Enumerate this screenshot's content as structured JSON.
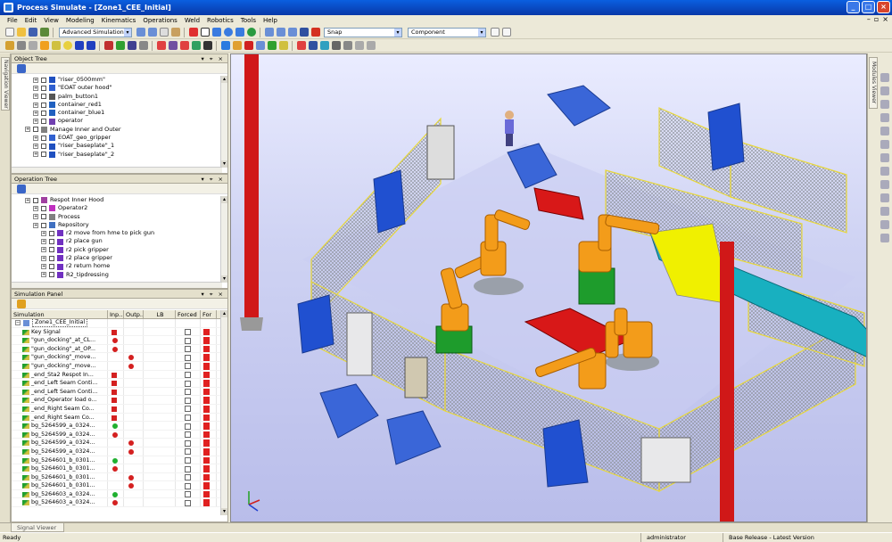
{
  "window": {
    "title": "Process Simulate - [Zone1_CEE_Initial]"
  },
  "menu": [
    "File",
    "Edit",
    "View",
    "Modeling",
    "Kinematics",
    "Operations",
    "Weld",
    "Robotics",
    "Tools",
    "Help"
  ],
  "toolbar": {
    "study_combo": "Advanced Simulation",
    "snap_combo": "Snap",
    "pick_combo": "Component"
  },
  "side_tabs": {
    "left": "Navigation Viewer",
    "right": "Modules Viewer"
  },
  "object_tree": {
    "title": "Object Tree",
    "items": [
      {
        "label": "\"riser_0500mm\"",
        "indent": 2,
        "icon": "part-icon"
      },
      {
        "label": "\"EOAT outer hood\"",
        "indent": 2,
        "icon": "gripper-icon"
      },
      {
        "label": "palm_button1",
        "indent": 2,
        "icon": "button-icon"
      },
      {
        "label": "container_red1",
        "indent": 2,
        "icon": "container-icon"
      },
      {
        "label": "container_blue1",
        "indent": 2,
        "icon": "container-icon"
      },
      {
        "label": "operator",
        "indent": 2,
        "icon": "human-icon"
      },
      {
        "label": "Manage Inner and Outer",
        "indent": 1,
        "icon": "station-icon"
      },
      {
        "label": "EOAT_geo_gripper",
        "indent": 2,
        "icon": "gripper-icon"
      },
      {
        "label": "\"riser_baseplate\"_1",
        "indent": 2,
        "icon": "part-icon"
      },
      {
        "label": "\"riser_baseplate\"_2",
        "indent": 2,
        "icon": "part-icon"
      }
    ]
  },
  "operation_tree": {
    "title": "Operation Tree",
    "items": [
      {
        "label": "Respot Inner Hood",
        "indent": 1,
        "icon": "compound-op-icon"
      },
      {
        "label": "Operator2",
        "indent": 2,
        "icon": "human-op-icon"
      },
      {
        "label": "Process",
        "indent": 2,
        "icon": "process-icon"
      },
      {
        "label": "Repository",
        "indent": 2,
        "icon": "repository-icon"
      },
      {
        "label": "r2 move from hme to pick gun",
        "indent": 3,
        "icon": "robot-op-icon"
      },
      {
        "label": "r2 place gun",
        "indent": 3,
        "icon": "robot-op-icon"
      },
      {
        "label": "r2 pick gripper",
        "indent": 3,
        "icon": "robot-op-icon"
      },
      {
        "label": "r2 place gripper",
        "indent": 3,
        "icon": "robot-op-icon"
      },
      {
        "label": "r2 return home",
        "indent": 3,
        "icon": "robot-op-icon"
      },
      {
        "label": "R2_tipdressing",
        "indent": 3,
        "icon": "robot-op-icon"
      }
    ]
  },
  "simulation_panel": {
    "title": "Simulation Panel",
    "columns": [
      "Simulation",
      "Inp...",
      "Outp...",
      "LB",
      "Forced",
      "For"
    ],
    "root": "Zone1_CEE_Initial",
    "rows": [
      {
        "name": "Key Signal",
        "input": "square",
        "output": ""
      },
      {
        "name": "\"gun_docking\"_at_CL...",
        "input": "red",
        "output": ""
      },
      {
        "name": "\"gun_docking\"_at_OP...",
        "input": "red",
        "output": ""
      },
      {
        "name": "\"gun_docking\"_move...",
        "input": "",
        "output": "red"
      },
      {
        "name": "\"gun_docking\"_move...",
        "input": "",
        "output": "red"
      },
      {
        "name": "_end_Sta2 Respot In...",
        "input": "square",
        "output": ""
      },
      {
        "name": "_end_Left Seam Conti...",
        "input": "square",
        "output": ""
      },
      {
        "name": "_end_Left Seam Conti...",
        "input": "square",
        "output": ""
      },
      {
        "name": "_end_Operator load o...",
        "input": "square",
        "output": ""
      },
      {
        "name": "_end_Right Seam Co...",
        "input": "square",
        "output": ""
      },
      {
        "name": "_end_Right Seam Co...",
        "input": "square",
        "output": ""
      },
      {
        "name": "bg_5264599_a_0324...",
        "input": "green",
        "output": ""
      },
      {
        "name": "bg_5264599_a_0324...",
        "input": "red",
        "output": ""
      },
      {
        "name": "bg_5264599_a_0324...",
        "input": "",
        "output": "red"
      },
      {
        "name": "bg_5264599_a_0324...",
        "input": "",
        "output": "red"
      },
      {
        "name": "bg_5264601_b_0301...",
        "input": "green",
        "output": ""
      },
      {
        "name": "bg_5264601_b_0301...",
        "input": "red",
        "output": ""
      },
      {
        "name": "bg_5264601_b_0301...",
        "input": "",
        "output": "red"
      },
      {
        "name": "bg_5264601_b_0301...",
        "input": "",
        "output": "red"
      },
      {
        "name": "bg_5264603_a_0324...",
        "input": "green",
        "output": ""
      },
      {
        "name": "bg_5264603_a_0324...",
        "input": "red",
        "output": ""
      }
    ]
  },
  "bottom_tab": "Signal Viewer",
  "status": {
    "left": "Ready",
    "user": "administrator",
    "version": "Base Release - Latest Version"
  },
  "colors": {
    "title_bar": "#0a5fe0",
    "chrome": "#ece9d8",
    "robot": "#f39c1a",
    "fence": "#8a8f96",
    "post": "#e8d83a",
    "bin": "#3a66d8",
    "pillar": "#d01818"
  }
}
